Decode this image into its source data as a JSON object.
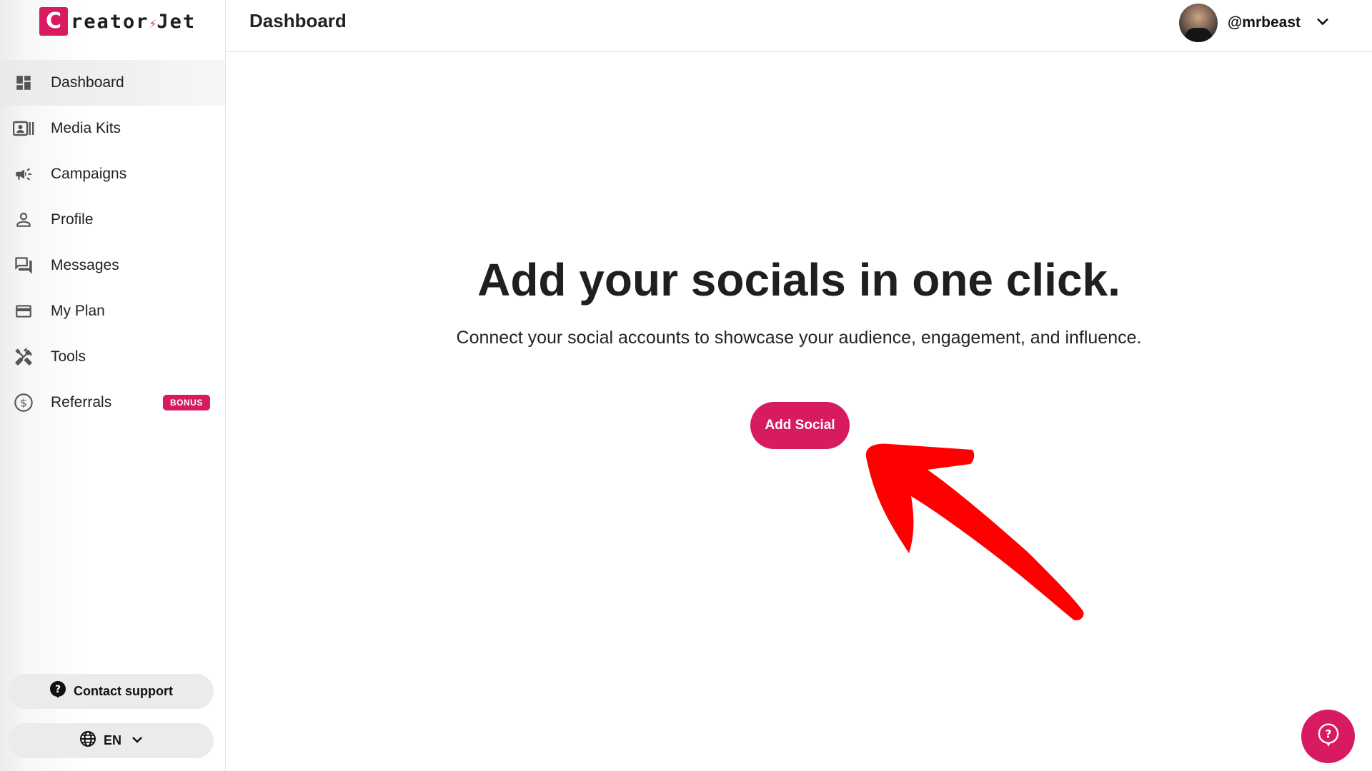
{
  "brand": {
    "logo_letter": "C",
    "logo_text_a": "reator",
    "logo_bolt": "⚡",
    "logo_text_b": "Jet",
    "accent_color": "#d81b60"
  },
  "header": {
    "title": "Dashboard",
    "username": "@mrbeast"
  },
  "sidebar": {
    "items": [
      {
        "label": "Dashboard",
        "icon": "dashboard-icon",
        "active": true
      },
      {
        "label": "Media Kits",
        "icon": "media-kits-icon"
      },
      {
        "label": "Campaigns",
        "icon": "megaphone-icon"
      },
      {
        "label": "Profile",
        "icon": "person-icon"
      },
      {
        "label": "Messages",
        "icon": "chat-icon"
      },
      {
        "label": "My Plan",
        "icon": "credit-card-icon"
      },
      {
        "label": "Tools",
        "icon": "tools-icon"
      },
      {
        "label": "Referrals",
        "icon": "dollar-circle-icon",
        "badge": "BONUS"
      }
    ],
    "support_label": "Contact support",
    "language": "EN"
  },
  "main": {
    "headline": "Add your socials in one click.",
    "subtext": "Connect your social accounts to showcase your audience, engagement, and influence.",
    "add_button_label": "Add Social"
  },
  "annotation": {
    "arrow_color": "#ff0000"
  }
}
